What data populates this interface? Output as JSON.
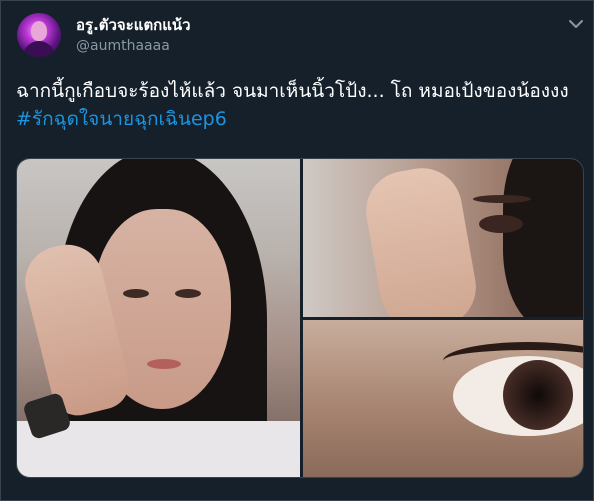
{
  "author": {
    "display_name": "อรู.ตัวจะแตกแน้ว",
    "handle": "@aumthaaaa"
  },
  "tweet": {
    "text": "ฉากนี้กูเกือบจะร้องไห้แล้ว จนมาเห็นนิ้วโป้ง... โถ หมอเป้งของน้องงง ",
    "hashtag": "#รักฉุดใจนายฉุกเฉินep6"
  },
  "icons": {
    "more": "chevron-down-icon"
  },
  "colors": {
    "background": "#15202b",
    "border": "#38444d",
    "text": "#ffffff",
    "secondary_text": "#8899a6",
    "hashtag": "#1b95e0"
  },
  "media": {
    "photo_count": 3
  }
}
